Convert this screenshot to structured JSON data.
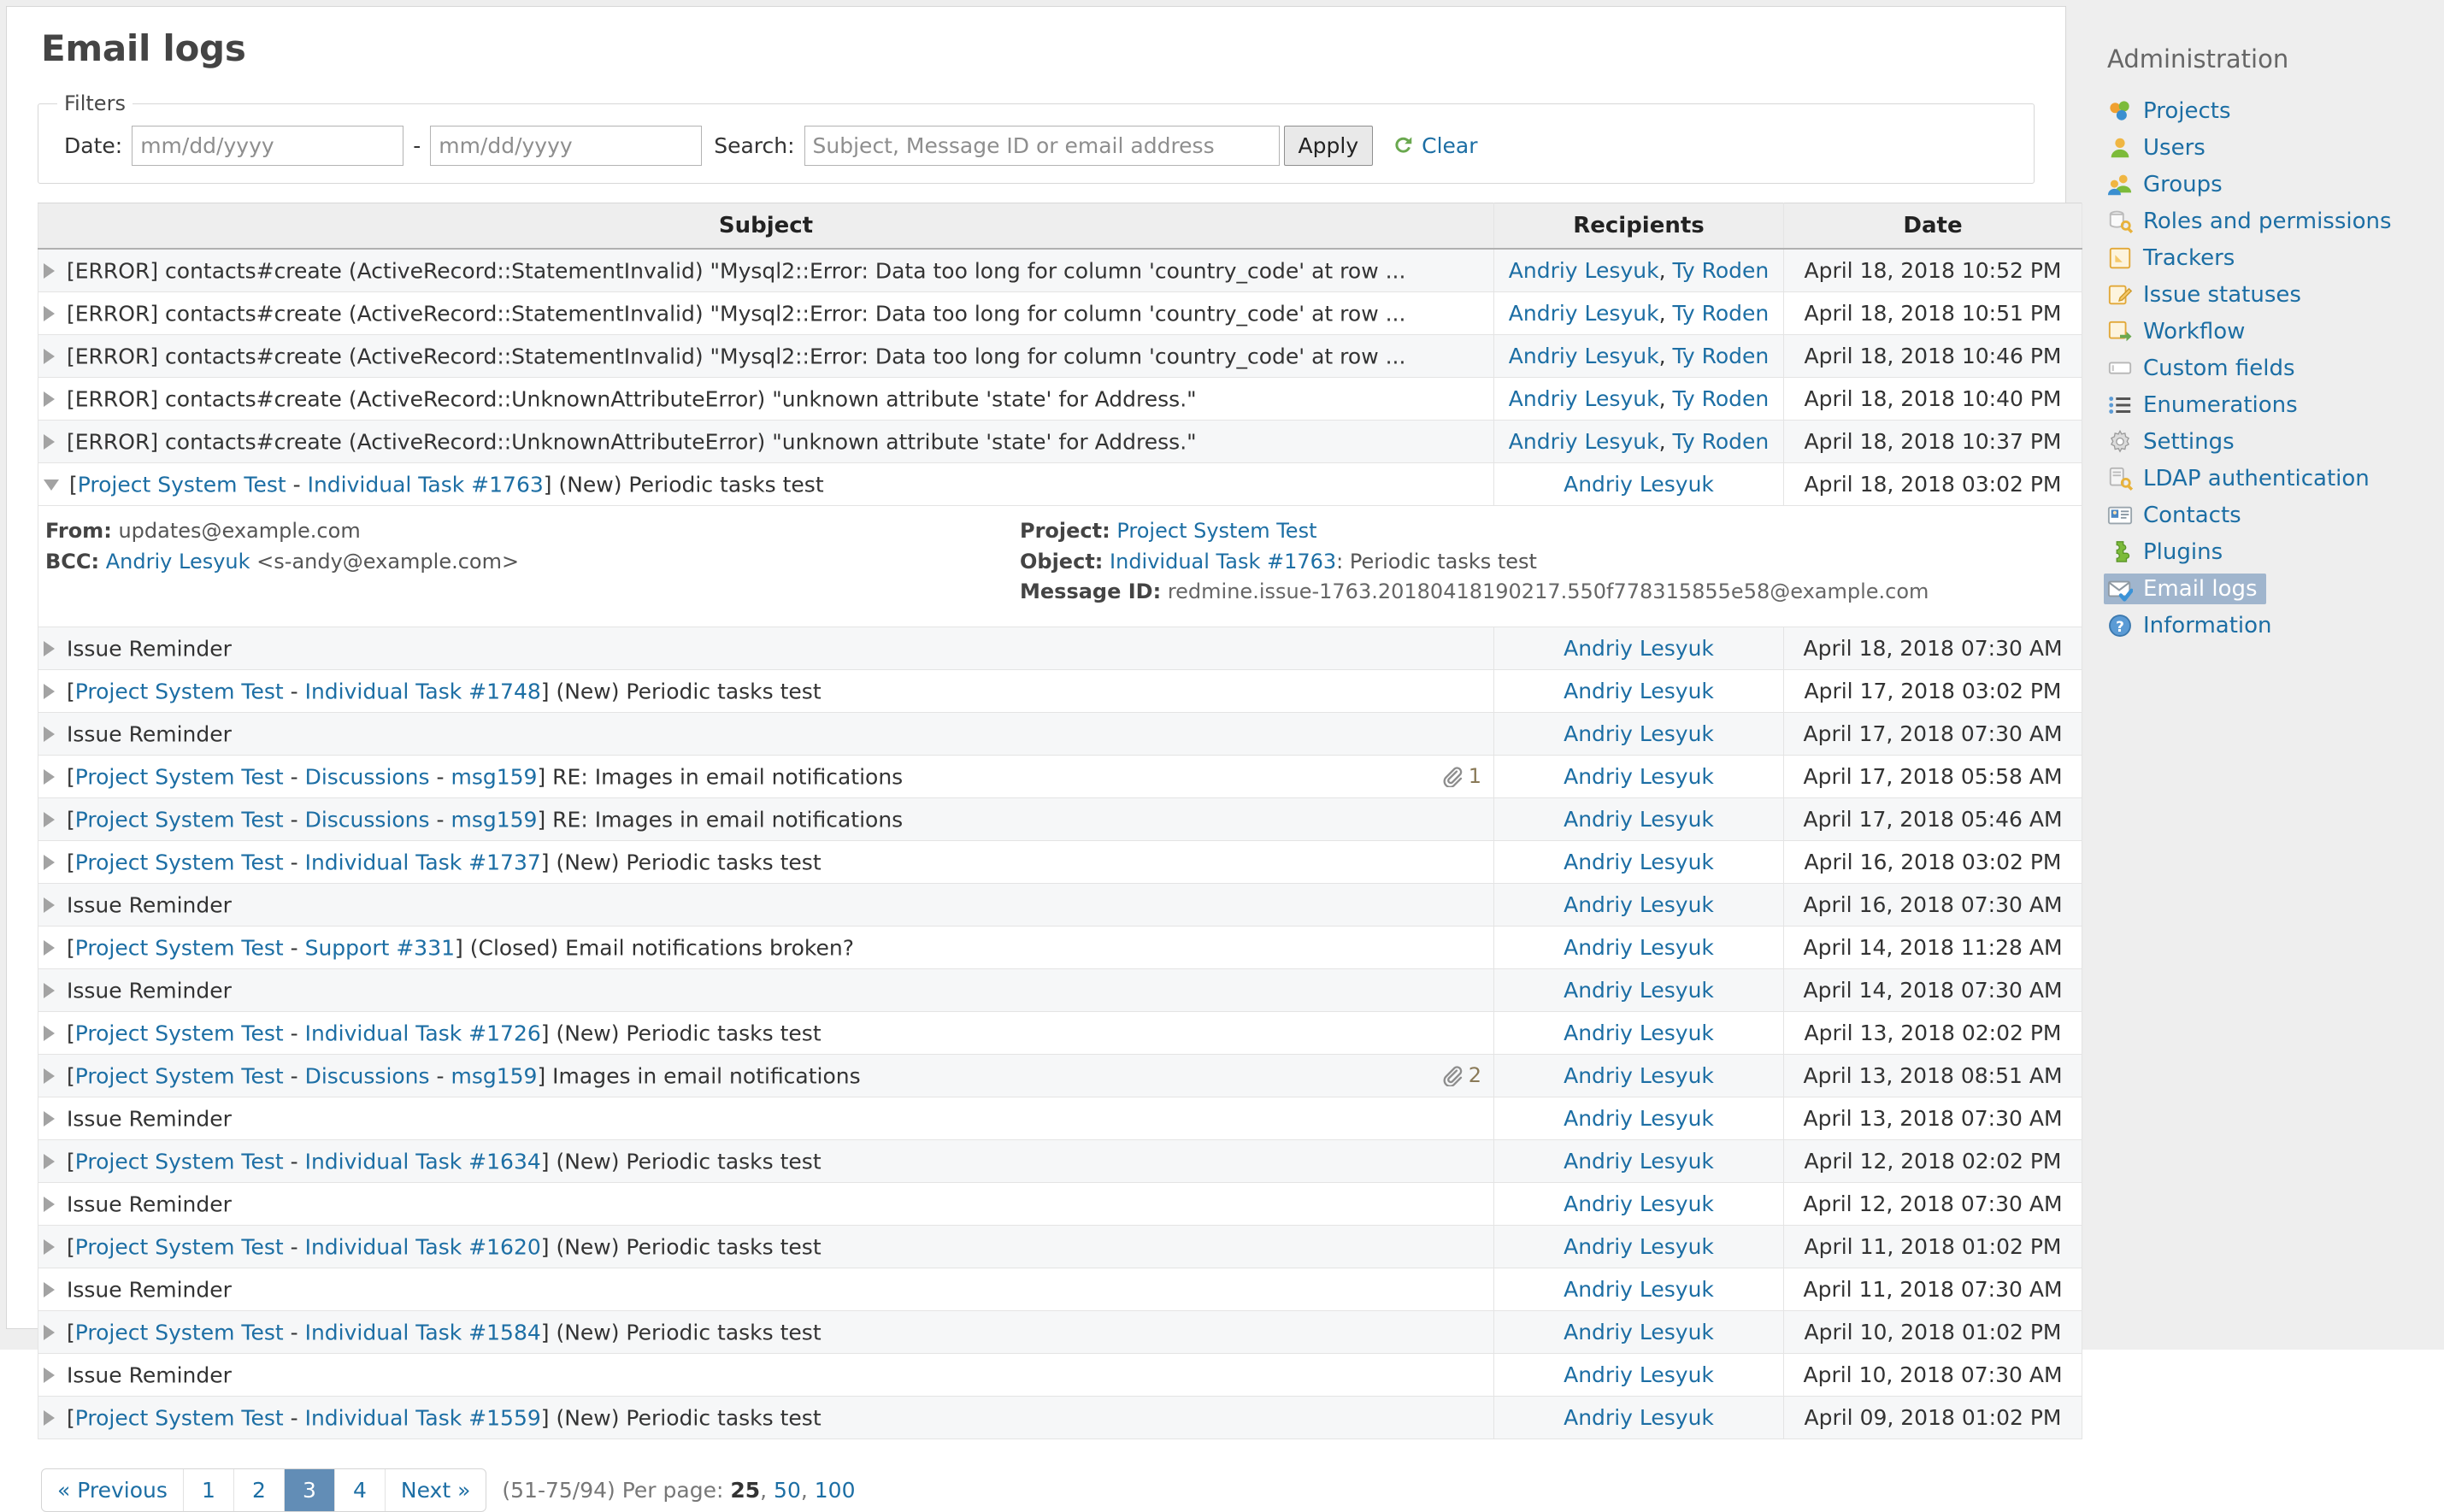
{
  "page": {
    "title": "Email logs"
  },
  "filters": {
    "legend": "Filters",
    "date_label": "Date:",
    "date_from_placeholder": "mm/dd/yyyy",
    "date_from_value": "",
    "date_to_placeholder": "mm/dd/yyyy",
    "date_to_value": "",
    "separator": "-",
    "search_label": "Search:",
    "search_placeholder": "Subject, Message ID or email address",
    "search_value": "",
    "apply_label": "Apply",
    "clear_label": "Clear"
  },
  "table": {
    "headers": {
      "subject": "Subject",
      "recipients": "Recipients",
      "date": "Date"
    },
    "rows": [
      {
        "subject_plain": "[ERROR] contacts#create (ActiveRecord::StatementInvalid) \"Mysql2::Error: Data too long for column 'country_code' at row ...",
        "recipients": "Andriy Lesyuk, Ty Roden",
        "date": "April 18, 2018 10:52 PM"
      },
      {
        "subject_plain": "[ERROR] contacts#create (ActiveRecord::StatementInvalid) \"Mysql2::Error: Data too long for column 'country_code' at row ...",
        "recipients": "Andriy Lesyuk, Ty Roden",
        "date": "April 18, 2018 10:51 PM"
      },
      {
        "subject_plain": "[ERROR] contacts#create (ActiveRecord::StatementInvalid) \"Mysql2::Error: Data too long for column 'country_code' at row ...",
        "recipients": "Andriy Lesyuk, Ty Roden",
        "date": "April 18, 2018 10:46 PM"
      },
      {
        "subject_plain": "[ERROR] contacts#create (ActiveRecord::UnknownAttributeError) \"unknown attribute 'state' for Address.\"",
        "recipients": "Andriy Lesyuk, Ty Roden",
        "date": "April 18, 2018 10:40 PM"
      },
      {
        "subject_plain": "[ERROR] contacts#create (ActiveRecord::UnknownAttributeError) \"unknown attribute 'state' for Address.\"",
        "recipients": "Andriy Lesyuk, Ty Roden",
        "date": "April 18, 2018 10:37 PM"
      },
      {
        "expanded": true,
        "subject_parts": [
          {
            "text": "[",
            "type": "plain"
          },
          {
            "text": "Project System Test",
            "type": "link"
          },
          {
            "text": " - ",
            "type": "plain"
          },
          {
            "text": "Individual Task #1763",
            "type": "strike-link"
          },
          {
            "text": "] (New) Periodic tasks test",
            "type": "plain"
          }
        ],
        "recipients": "Andriy Lesyuk",
        "date": "April 18, 2018 03:02 PM",
        "detail": {
          "from_key": "From:",
          "from_value": "updates@example.com",
          "bcc_key": "BCC:",
          "bcc_name": "Andriy Lesyuk",
          "bcc_address": "<s-andy@example.com>",
          "project_key": "Project:",
          "project_value": "Project System Test",
          "object_key": "Object:",
          "object_link": "Individual Task #1763",
          "object_rest": ": Periodic tasks test",
          "message_id_key": "Message ID:",
          "message_id_value": "redmine.issue-1763.20180418190217.550f778315855e58@example.com"
        }
      },
      {
        "subject_plain": "Issue Reminder",
        "recipients": "Andriy Lesyuk",
        "date": "April 18, 2018 07:30 AM"
      },
      {
        "subject_parts": [
          {
            "text": "[",
            "type": "plain"
          },
          {
            "text": "Project System Test",
            "type": "link"
          },
          {
            "text": " - ",
            "type": "plain"
          },
          {
            "text": "Individual Task #1748",
            "type": "strike-link"
          },
          {
            "text": "] (New) Periodic tasks test",
            "type": "plain"
          }
        ],
        "recipients": "Andriy Lesyuk",
        "date": "April 17, 2018 03:02 PM"
      },
      {
        "subject_plain": "Issue Reminder",
        "recipients": "Andriy Lesyuk",
        "date": "April 17, 2018 07:30 AM"
      },
      {
        "subject_parts": [
          {
            "text": "[",
            "type": "plain"
          },
          {
            "text": "Project System Test",
            "type": "link"
          },
          {
            "text": " - ",
            "type": "plain"
          },
          {
            "text": "Discussions",
            "type": "link"
          },
          {
            "text": " - ",
            "type": "plain"
          },
          {
            "text": "msg159",
            "type": "link"
          },
          {
            "text": "] RE: Images in email notifications",
            "type": "plain"
          }
        ],
        "attachments": "1",
        "recipients": "Andriy Lesyuk",
        "date": "April 17, 2018 05:58 AM"
      },
      {
        "subject_parts": [
          {
            "text": "[",
            "type": "plain"
          },
          {
            "text": "Project System Test",
            "type": "link"
          },
          {
            "text": " - ",
            "type": "plain"
          },
          {
            "text": "Discussions",
            "type": "link"
          },
          {
            "text": " - ",
            "type": "plain"
          },
          {
            "text": "msg159",
            "type": "link"
          },
          {
            "text": "] RE: Images in email notifications",
            "type": "plain"
          }
        ],
        "recipients": "Andriy Lesyuk",
        "date": "April 17, 2018 05:46 AM"
      },
      {
        "subject_parts": [
          {
            "text": "[",
            "type": "plain"
          },
          {
            "text": "Project System Test",
            "type": "link"
          },
          {
            "text": " - ",
            "type": "plain"
          },
          {
            "text": "Individual Task #1737",
            "type": "strike-link"
          },
          {
            "text": "] (New) Periodic tasks test",
            "type": "plain"
          }
        ],
        "recipients": "Andriy Lesyuk",
        "date": "April 16, 2018 03:02 PM"
      },
      {
        "subject_plain": "Issue Reminder",
        "recipients": "Andriy Lesyuk",
        "date": "April 16, 2018 07:30 AM"
      },
      {
        "subject_parts": [
          {
            "text": "[",
            "type": "plain"
          },
          {
            "text": "Project System Test",
            "type": "link"
          },
          {
            "text": " - ",
            "type": "plain"
          },
          {
            "text": "Support #331",
            "type": "strike-link"
          },
          {
            "text": "] (Closed) Email notifications broken?",
            "type": "plain"
          }
        ],
        "recipients": "Andriy Lesyuk",
        "date": "April 14, 2018 11:28 AM"
      },
      {
        "subject_plain": "Issue Reminder",
        "recipients": "Andriy Lesyuk",
        "date": "April 14, 2018 07:30 AM"
      },
      {
        "subject_parts": [
          {
            "text": "[",
            "type": "plain"
          },
          {
            "text": "Project System Test",
            "type": "link"
          },
          {
            "text": " - ",
            "type": "plain"
          },
          {
            "text": "Individual Task #1726",
            "type": "strike-link"
          },
          {
            "text": "] (New) Periodic tasks test",
            "type": "plain"
          }
        ],
        "recipients": "Andriy Lesyuk",
        "date": "April 13, 2018 02:02 PM"
      },
      {
        "subject_parts": [
          {
            "text": "[",
            "type": "plain"
          },
          {
            "text": "Project System Test",
            "type": "link"
          },
          {
            "text": " - ",
            "type": "plain"
          },
          {
            "text": "Discussions",
            "type": "link"
          },
          {
            "text": " - ",
            "type": "plain"
          },
          {
            "text": "msg159",
            "type": "link"
          },
          {
            "text": "] Images in email notifications",
            "type": "plain"
          }
        ],
        "attachments": "2",
        "recipients": "Andriy Lesyuk",
        "date": "April 13, 2018 08:51 AM"
      },
      {
        "subject_plain": "Issue Reminder",
        "recipients": "Andriy Lesyuk",
        "date": "April 13, 2018 07:30 AM"
      },
      {
        "subject_parts": [
          {
            "text": "[",
            "type": "plain"
          },
          {
            "text": "Project System Test",
            "type": "link"
          },
          {
            "text": " - ",
            "type": "plain"
          },
          {
            "text": "Individual Task #1634",
            "type": "strike-link"
          },
          {
            "text": "] (New) Periodic tasks test",
            "type": "plain"
          }
        ],
        "recipients": "Andriy Lesyuk",
        "date": "April 12, 2018 02:02 PM"
      },
      {
        "subject_plain": "Issue Reminder",
        "recipients": "Andriy Lesyuk",
        "date": "April 12, 2018 07:30 AM"
      },
      {
        "subject_parts": [
          {
            "text": "[",
            "type": "plain"
          },
          {
            "text": "Project System Test",
            "type": "link"
          },
          {
            "text": " - ",
            "type": "plain"
          },
          {
            "text": "Individual Task #1620",
            "type": "strike-link"
          },
          {
            "text": "] (New) Periodic tasks test",
            "type": "plain"
          }
        ],
        "recipients": "Andriy Lesyuk",
        "date": "April 11, 2018 01:02 PM"
      },
      {
        "subject_plain": "Issue Reminder",
        "recipients": "Andriy Lesyuk",
        "date": "April 11, 2018 07:30 AM"
      },
      {
        "subject_parts": [
          {
            "text": "[",
            "type": "plain"
          },
          {
            "text": "Project System Test",
            "type": "link"
          },
          {
            "text": " - ",
            "type": "plain"
          },
          {
            "text": "Individual Task #1584",
            "type": "strike-link"
          },
          {
            "text": "] (New) Periodic tasks test",
            "type": "plain"
          }
        ],
        "recipients": "Andriy Lesyuk",
        "date": "April 10, 2018 01:02 PM"
      },
      {
        "subject_plain": "Issue Reminder",
        "recipients": "Andriy Lesyuk",
        "date": "April 10, 2018 07:30 AM"
      },
      {
        "subject_parts": [
          {
            "text": "[",
            "type": "plain"
          },
          {
            "text": "Project System Test",
            "type": "link"
          },
          {
            "text": " - ",
            "type": "plain"
          },
          {
            "text": "Individual Task #1559",
            "type": "strike-link"
          },
          {
            "text": "] (New) Periodic tasks test",
            "type": "plain"
          }
        ],
        "recipients": "Andriy Lesyuk",
        "date": "April 09, 2018 01:02 PM"
      }
    ]
  },
  "pagination": {
    "previous_label": "« Previous",
    "pages": [
      "1",
      "2",
      "3",
      "4"
    ],
    "current_page": "3",
    "next_label": "Next »",
    "range_label": "(51-75/94)",
    "per_page_label": "Per page:",
    "per_page_options": [
      "25",
      "50",
      "100"
    ],
    "per_page_selected": "25"
  },
  "sidebar": {
    "title": "Administration",
    "items": [
      {
        "label": "Projects",
        "icon": "projects-icon",
        "selected": false
      },
      {
        "label": "Users",
        "icon": "users-icon",
        "selected": false
      },
      {
        "label": "Groups",
        "icon": "groups-icon",
        "selected": false
      },
      {
        "label": "Roles and permissions",
        "icon": "roles-key-icon",
        "selected": false
      },
      {
        "label": "Trackers",
        "icon": "trackers-icon",
        "selected": false
      },
      {
        "label": "Issue statuses",
        "icon": "issue-statuses-icon",
        "selected": false
      },
      {
        "label": "Workflow",
        "icon": "workflow-icon",
        "selected": false
      },
      {
        "label": "Custom fields",
        "icon": "custom-fields-icon",
        "selected": false
      },
      {
        "label": "Enumerations",
        "icon": "enumerations-icon",
        "selected": false
      },
      {
        "label": "Settings",
        "icon": "gear-icon",
        "selected": false
      },
      {
        "label": "LDAP authentication",
        "icon": "ldap-key-icon",
        "selected": false
      },
      {
        "label": "Contacts",
        "icon": "contacts-card-icon",
        "selected": false
      },
      {
        "label": "Plugins",
        "icon": "plugins-puzzle-icon",
        "selected": false
      },
      {
        "label": "Email logs",
        "icon": "email-logs-icon",
        "selected": true
      },
      {
        "label": "Information",
        "icon": "information-icon",
        "selected": false
      }
    ]
  }
}
